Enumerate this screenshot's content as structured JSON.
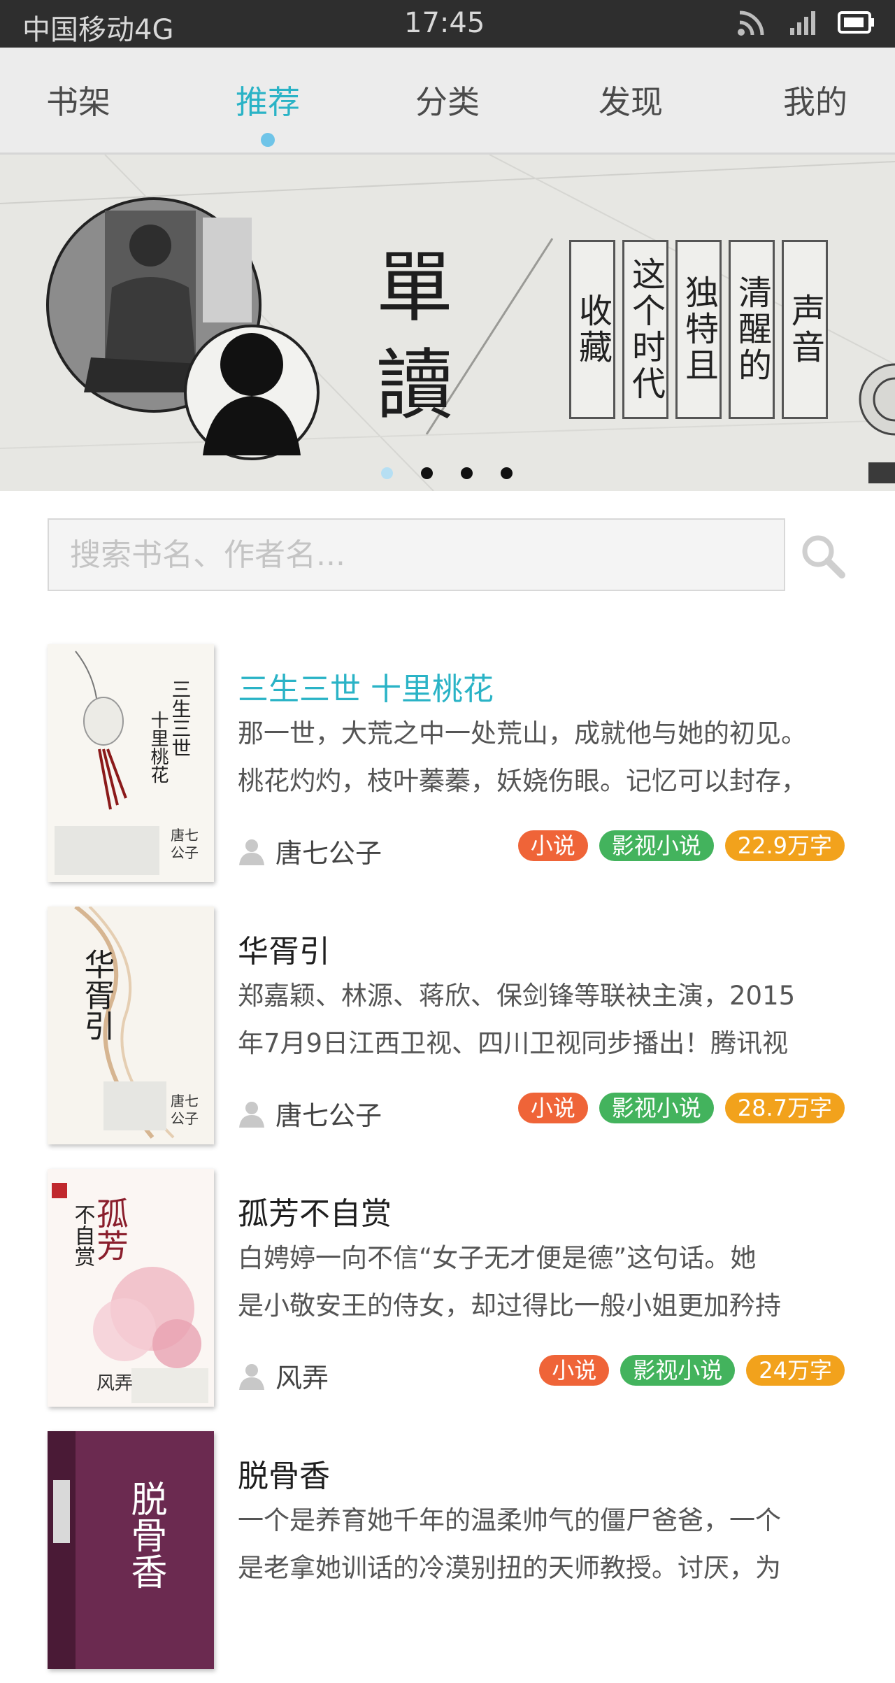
{
  "status_bar": {
    "carrier": "中国移动4G",
    "time": "17:45"
  },
  "tabs": [
    {
      "label": "书架"
    },
    {
      "label": "推荐",
      "active": true
    },
    {
      "label": "分类"
    },
    {
      "label": "发现"
    },
    {
      "label": "我的"
    }
  ],
  "banner": {
    "title_chars": [
      "單",
      "讀"
    ],
    "columns": [
      "声音",
      "清醒的",
      "独特且",
      "这个时代",
      "收藏"
    ],
    "dots": 4,
    "active_dot": 0
  },
  "search": {
    "placeholder": "搜索书名、作者名..."
  },
  "books": [
    {
      "title": "三生三世 十里桃花",
      "desc_line1": "那一世，大荒之中一处荒山，成就他与她的初见。",
      "desc_line2": "桃花灼灼，枝叶蓁蓁，妖娆伤眼。记忆可以封存，",
      "author": "唐七公子",
      "tags": [
        "小说",
        "影视小说",
        "22.9万字"
      ],
      "highlight": true
    },
    {
      "title": "华胥引",
      "desc_line1": "郑嘉颖、林源、蒋欣、保剑锋等联袂主演，2015",
      "desc_line2": "年7月9日江西卫视、四川卫视同步播出！腾讯视",
      "author": "唐七公子",
      "tags": [
        "小说",
        "影视小说",
        "28.7万字"
      ]
    },
    {
      "title": "孤芳不自赏",
      "desc_line1": "白娉婷一向不信“女子无才便是德”这句话。她",
      "desc_line2": "是小敬安王的侍女，却过得比一般小姐更加矜持",
      "author": "风弄",
      "tags": [
        "小说",
        "影视小说",
        "24万字"
      ]
    },
    {
      "title": "脱骨香",
      "desc_line1": "一个是养育她千年的温柔帅气的僵尸爸爸，一个",
      "desc_line2": "是老拿她训话的冷漠别扭的天师教授。讨厌，为",
      "author": "",
      "tags": []
    }
  ],
  "colors": {
    "accent": "#2ab3c6",
    "tag_novel": "#ef6438",
    "tag_film": "#43b35d",
    "tag_words": "#f2a21c"
  }
}
